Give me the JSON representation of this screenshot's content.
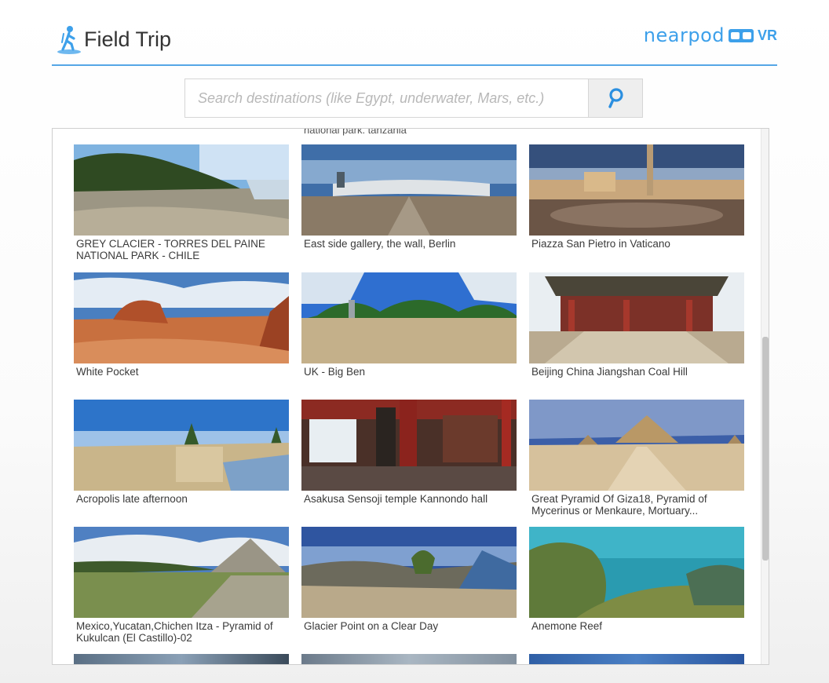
{
  "header": {
    "title": "Field Trip",
    "brand": "nearpod",
    "brand_suffix": "VR",
    "accent_color": "#3da0ea",
    "icon": "hiker-icon"
  },
  "search": {
    "placeholder": "Search destinations (like Egypt, underwater, Mars, etc.)",
    "value": "",
    "button_icon": "search-icon"
  },
  "results": {
    "cut_off_caption": "national park. tanzania",
    "items": [
      {
        "caption": "GREY CLACIER - TORRES DEL PAINE NATIONAL PARK - CHILE"
      },
      {
        "caption": "East side gallery, the wall, Berlin"
      },
      {
        "caption": "Piazza San Pietro in Vaticano"
      },
      {
        "caption": "White Pocket"
      },
      {
        "caption": "UK - Big Ben"
      },
      {
        "caption": "Beijing China Jiangshan Coal Hill"
      },
      {
        "caption": "Acropolis late afternoon"
      },
      {
        "caption": "Asakusa Sensoji temple Kannondo hall"
      },
      {
        "caption": "Great Pyramid Of Giza18, Pyramid of Mycerinus or Menkaure, Mortuary..."
      },
      {
        "caption": "Mexico,Yucatan,Chichen Itza - Pyramid of Kukulcan (El Castillo)-02"
      },
      {
        "caption": "Glacier Point on a Clear Day"
      },
      {
        "caption": "Anemone Reef"
      }
    ]
  }
}
